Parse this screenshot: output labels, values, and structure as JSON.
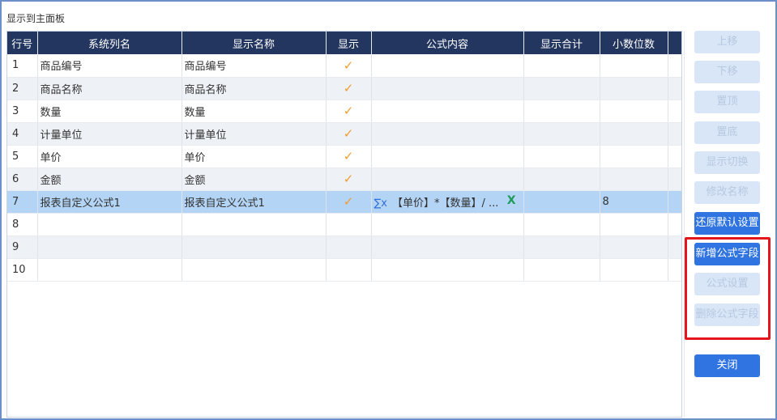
{
  "window": {
    "title": "显示到主面板"
  },
  "table": {
    "columns": [
      "行号",
      "系统列名",
      "显示名称",
      "显示",
      "公式内容",
      "显示合计",
      "小数位数"
    ],
    "rows": [
      {
        "num": "1",
        "sys": "商品编号",
        "disp": "商品编号",
        "show": "✓",
        "formula": "",
        "total": "",
        "decimals": ""
      },
      {
        "num": "2",
        "sys": "商品名称",
        "disp": "商品名称",
        "show": "✓",
        "formula": "",
        "total": "",
        "decimals": ""
      },
      {
        "num": "3",
        "sys": "数量",
        "disp": "数量",
        "show": "✓",
        "formula": "",
        "total": "",
        "decimals": ""
      },
      {
        "num": "4",
        "sys": "计量单位",
        "disp": "计量单位",
        "show": "✓",
        "formula": "",
        "total": "",
        "decimals": ""
      },
      {
        "num": "5",
        "sys": "单价",
        "disp": "单价",
        "show": "✓",
        "formula": "",
        "total": "",
        "decimals": ""
      },
      {
        "num": "6",
        "sys": "金额",
        "disp": "金额",
        "show": "✓",
        "formula": "",
        "total": "",
        "decimals": ""
      },
      {
        "num": "7",
        "sys": "报表自定义公式1",
        "disp": "报表自定义公式1",
        "show": "✓",
        "formula": "【单价】*【数量】/ ...",
        "total": "",
        "decimals": "8"
      },
      {
        "num": "8",
        "sys": "",
        "disp": "",
        "show": "",
        "formula": "",
        "total": "",
        "decimals": ""
      },
      {
        "num": "9",
        "sys": "",
        "disp": "",
        "show": "",
        "formula": "",
        "total": "",
        "decimals": ""
      },
      {
        "num": "10",
        "sys": "",
        "disp": "",
        "show": "",
        "formula": "",
        "total": "",
        "decimals": ""
      }
    ]
  },
  "buttons": {
    "move_up": "上移",
    "move_down": "下移",
    "to_top": "置顶",
    "to_bottom": "置底",
    "toggle_display": "显示切换",
    "rename": "修改名称",
    "restore_default": "还原默认设置",
    "add_formula_field": "新增公式字段",
    "formula_settings": "公式设置",
    "delete_formula_field": "删除公式字段",
    "close": "关闭"
  },
  "icons": {
    "formula": "∑x",
    "clear": "X",
    "check": "✓"
  },
  "colors": {
    "header_bg": "#23365f",
    "selected_row": "#b3d4f5",
    "primary": "#2f74e0",
    "disabled": "#d9e6f7",
    "highlight": "#e5161b",
    "check": "#f29d2f"
  }
}
